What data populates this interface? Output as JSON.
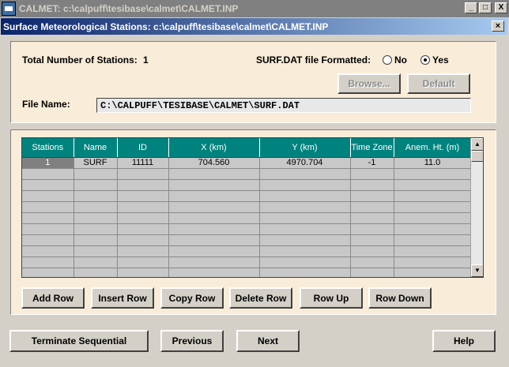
{
  "window": {
    "title": "CALMET: c:\\calpuff\\tesibase\\calmet\\CALMET.INP",
    "minimize": "_",
    "maximize": "□",
    "close": "X"
  },
  "dialog": {
    "title": "Surface Meteorological Stations: c:\\calpuff\\tesibase\\calmet\\CALMET.INP",
    "close": "×"
  },
  "top": {
    "total_label": "Total Number of Stations:",
    "total_value": "1",
    "formatted_label": "SURF.DAT file Formatted:",
    "radio_no": "No",
    "radio_yes": "Yes",
    "selected": "Yes",
    "browse_button": "Browse...",
    "default_button": "Default",
    "file_name_label": "File Name:",
    "file_name_value": "C:\\CALPUFF\\TESIBASE\\CALMET\\SURF.DAT"
  },
  "table": {
    "columns": [
      "Stations",
      "Name",
      "ID",
      "X (km)",
      "Y (km)",
      "Time Zone",
      "Anem. Ht. (m)"
    ],
    "rows": [
      [
        "1",
        "SURF",
        "11111",
        "704.560",
        "4970.704",
        "-1",
        "11.0"
      ]
    ],
    "empty_rows": 10
  },
  "row_buttons": {
    "add": "Add Row",
    "insert": "Insert Row",
    "copy": "Copy Row",
    "delete": "Delete Row",
    "up": "Row Up",
    "down": "Row Down"
  },
  "nav_buttons": {
    "terminate": "Terminate Sequential",
    "previous": "Previous",
    "next": "Next",
    "help": "Help"
  }
}
